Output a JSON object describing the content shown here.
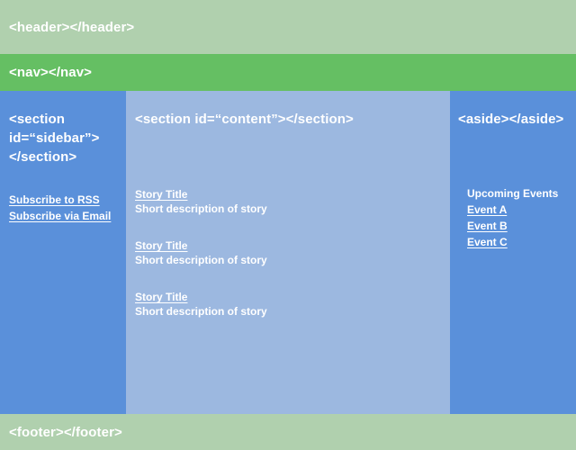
{
  "header": {
    "label": "<header></header>",
    "bg_color": "#b0d0ae"
  },
  "nav": {
    "label": "<nav></nav>",
    "bg_color": "#65bf63"
  },
  "sidebar": {
    "heading": "<section id=“sidebar”></section>",
    "bg_color": "#5a90da",
    "links": [
      {
        "label": "Subscribe to RSS"
      },
      {
        "label": "Subscribe via Email"
      }
    ]
  },
  "content": {
    "heading": "<section id=“content”></section>",
    "bg_color": "#9cb8e0",
    "stories": [
      {
        "title": "Story Title",
        "description": "Short description of story"
      },
      {
        "title": "Story Title",
        "description": "Short description of story"
      },
      {
        "title": "Story Title",
        "description": "Short description of story"
      }
    ]
  },
  "aside": {
    "heading": "<aside></aside>",
    "bg_color": "#5a90da",
    "events_heading": "Upcoming Events",
    "events": [
      {
        "label": "Event A"
      },
      {
        "label": "Event B"
      },
      {
        "label": "Event C"
      }
    ]
  },
  "footer": {
    "label": "<footer></footer>",
    "bg_color": "#b0d0ae"
  },
  "text_color": "#ffffff"
}
